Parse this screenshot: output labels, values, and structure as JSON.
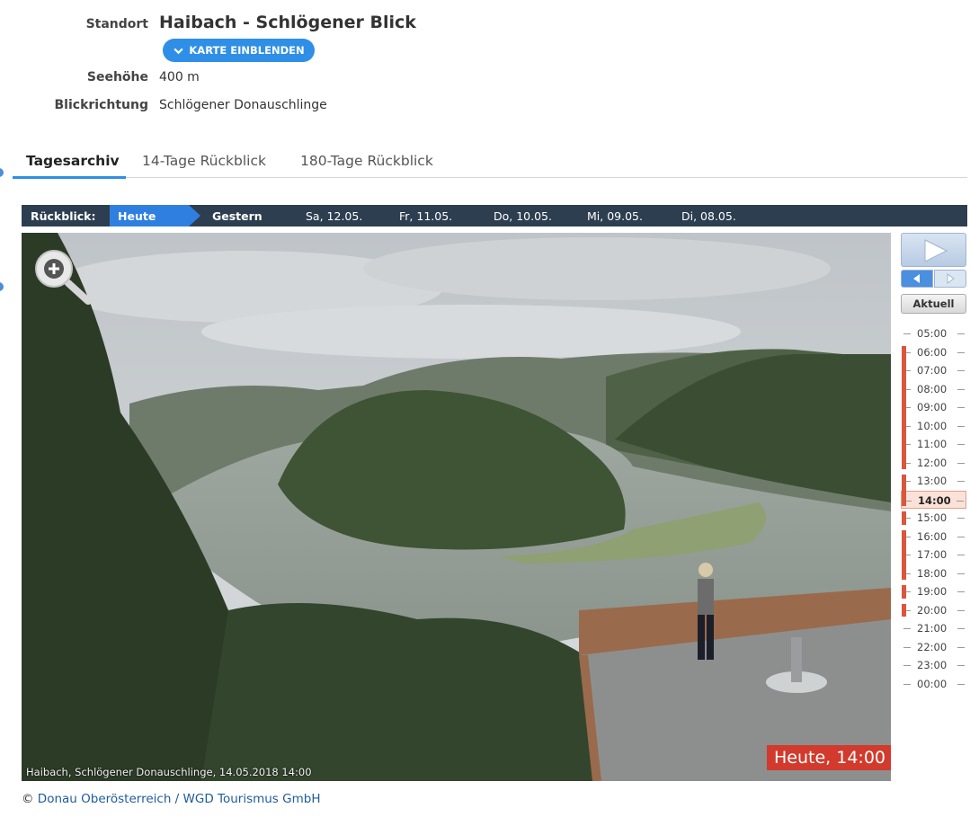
{
  "info": {
    "location_label": "Standort",
    "location_value": "Haibach - Schlögener Blick",
    "map_button": "KARTE EINBLENDEN",
    "altitude_label": "Seehöhe",
    "altitude_value": "400 m",
    "direction_label": "Blickrichtung",
    "direction_value": "Schlögener Donauschlinge"
  },
  "tabs": [
    {
      "label": "Tagesarchiv",
      "active": true
    },
    {
      "label": "14-Tage Rückblick",
      "active": false
    },
    {
      "label": "180-Tage Rückblick",
      "active": false
    }
  ],
  "daybar": {
    "label": "Rückblick:",
    "today": "Heute",
    "days": [
      "Gestern",
      "Sa, 12.05.",
      "Fr, 11.05.",
      "Do, 10.05.",
      "Mi, 09.05.",
      "Di, 08.05."
    ]
  },
  "webcam": {
    "caption": "Haibach, Schlögener Donauschlinge, 14.05.2018 14:00",
    "stamp": "Heute, 14:00",
    "zoom_icon": "zoom-in-icon"
  },
  "controls": {
    "play_icon": "play-icon",
    "prev_icon": "step-back-icon",
    "next_icon": "step-forward-icon",
    "now_label": "Aktuell"
  },
  "timeline": {
    "times": [
      "05:00",
      "06:00",
      "07:00",
      "08:00",
      "09:00",
      "10:00",
      "11:00",
      "12:00",
      "13:00",
      "14:00",
      "15:00",
      "16:00",
      "17:00",
      "18:00",
      "19:00",
      "20:00",
      "21:00",
      "22:00",
      "23:00",
      "00:00"
    ],
    "active": "14:00",
    "accent": "#d9573c"
  },
  "credit": {
    "symbol": "©",
    "text": "Donau Oberösterreich / WGD Tourismus GmbH"
  }
}
